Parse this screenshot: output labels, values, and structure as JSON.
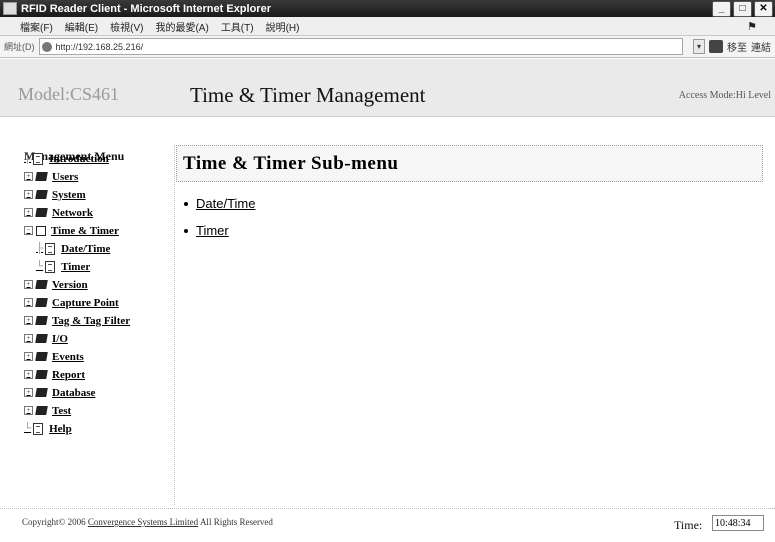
{
  "window": {
    "title": "RFID Reader Client - Microsoft Internet Explorer",
    "buttons": [
      "_",
      "□",
      "✕"
    ]
  },
  "menubar": {
    "items": [
      "檔案(F)",
      "編輯(E)",
      "檢視(V)",
      "我的最愛(A)",
      "工具(T)",
      "說明(H)"
    ]
  },
  "addressbar": {
    "label": "網址(D)",
    "url": "http://192.168.25.216/",
    "go_label": "移至",
    "links_label": "連結"
  },
  "header": {
    "model": "Model:CS461",
    "title": "Time & Timer Management",
    "access_mode": "Access Mode:Hi Level"
  },
  "sidebar": {
    "title": "Management Menu",
    "items": [
      {
        "label": "Introduction"
      },
      {
        "label": "Users"
      },
      {
        "label": "System"
      },
      {
        "label": "Network"
      },
      {
        "label": "Time & Timer"
      },
      {
        "label": "Date/Time"
      },
      {
        "label": "Timer"
      },
      {
        "label": "Version"
      },
      {
        "label": "Capture Point"
      },
      {
        "label": "Tag & Tag Filter"
      },
      {
        "label": "I/O"
      },
      {
        "label": "Events"
      },
      {
        "label": "Report"
      },
      {
        "label": "Database"
      },
      {
        "label": "Test"
      },
      {
        "label": "Help"
      }
    ]
  },
  "main": {
    "submenu_title": "Time & Timer Sub-menu",
    "links": [
      "Date/Time",
      "Timer"
    ]
  },
  "footer": {
    "copyright_prefix": "Copyright© 2006",
    "company": "Convergence Systems Limited",
    "rights": "All Rights Reserved",
    "time_label": "Time:",
    "time_value": "10:48:34"
  }
}
